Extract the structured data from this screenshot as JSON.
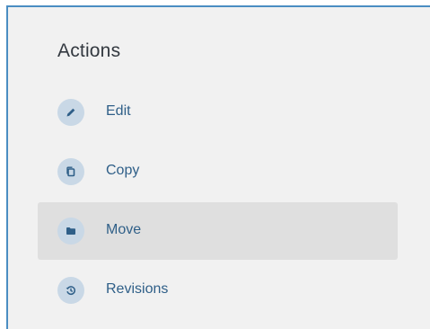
{
  "panel": {
    "title": "Actions",
    "accent_color": "#4a8dc2",
    "items": [
      {
        "label": "Edit",
        "icon": "pencil-icon",
        "active": false
      },
      {
        "label": "Copy",
        "icon": "copy-icon",
        "active": false
      },
      {
        "label": "Move",
        "icon": "folder-icon",
        "active": true
      },
      {
        "label": "Revisions",
        "icon": "history-icon",
        "active": false
      }
    ]
  }
}
